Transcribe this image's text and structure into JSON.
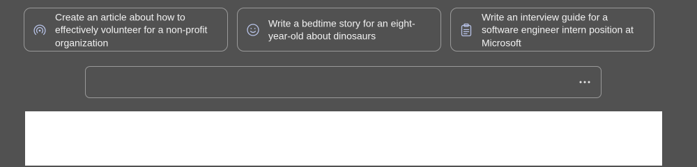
{
  "suggestions": [
    {
      "icon": "podcast-icon",
      "text": "Create an article about how to effectively volunteer for a non-profit organization"
    },
    {
      "icon": "smile-icon",
      "text": "Write a bedtime story for an eight-year-old about dinosaurs"
    },
    {
      "icon": "clipboard-icon",
      "text": "Write an interview guide for a software engineer intern position at Microsoft"
    }
  ],
  "colors": {
    "background": "#515151",
    "card_border": "#9a9a9a",
    "text": "#f1f1f1",
    "icon": "#b8c3e8",
    "panel": "#ffffff"
  },
  "input": {
    "more_icon": "more-horizontal-icon"
  }
}
